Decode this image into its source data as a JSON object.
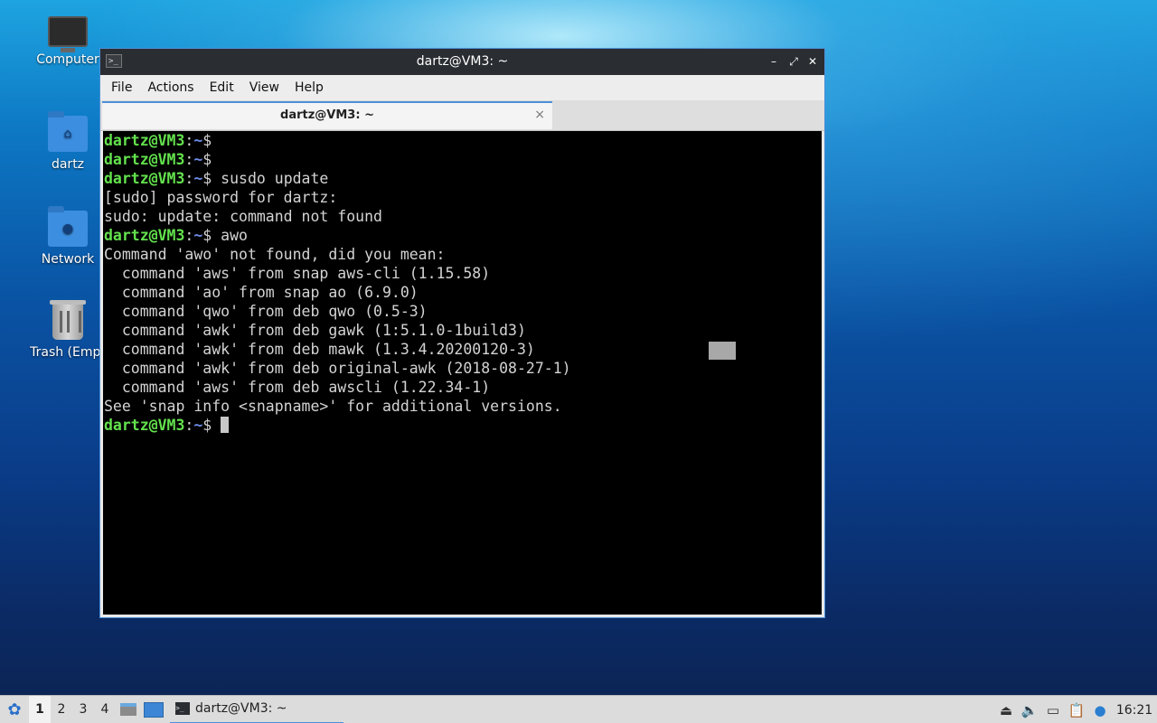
{
  "desktop": {
    "icons": [
      {
        "label": "Computer"
      },
      {
        "label": "dartz"
      },
      {
        "label": "Network"
      },
      {
        "label": "Trash (Empt"
      }
    ]
  },
  "window": {
    "title": "dartz@VM3: ~",
    "controls": {
      "minimize": "–",
      "maximize": "⤢",
      "close": "✕"
    },
    "menu": [
      "File",
      "Actions",
      "Edit",
      "View",
      "Help"
    ],
    "tab": {
      "label": "dartz@VM3: ~",
      "close": "×"
    }
  },
  "terminal": {
    "prompt_user": "dartz@VM3",
    "prompt_sep": ":",
    "prompt_path": "~",
    "prompt_sym": "$",
    "lines": [
      {
        "prompt": true,
        "text": ""
      },
      {
        "prompt": true,
        "text": ""
      },
      {
        "prompt": true,
        "text": " susdo update"
      },
      {
        "prompt": false,
        "text": "[sudo] password for dartz:"
      },
      {
        "prompt": false,
        "text": "sudo: update: command not found"
      },
      {
        "prompt": true,
        "text": " awo"
      },
      {
        "prompt": false,
        "text": "Command 'awo' not found, did you mean:"
      },
      {
        "prompt": false,
        "text": "  command 'aws' from snap aws-cli (1.15.58)"
      },
      {
        "prompt": false,
        "text": "  command 'ao' from snap ao (6.9.0)"
      },
      {
        "prompt": false,
        "text": "  command 'qwo' from deb qwo (0.5-3)"
      },
      {
        "prompt": false,
        "text": "  command 'awk' from deb gawk (1:5.1.0-1build3)"
      },
      {
        "prompt": false,
        "text": "  command 'awk' from deb mawk (1.3.4.20200120-3)"
      },
      {
        "prompt": false,
        "text": "  command 'awk' from deb original-awk (2018-08-27-1)"
      },
      {
        "prompt": false,
        "text": "  command 'aws' from deb awscli (1.22.34-1)"
      },
      {
        "prompt": false,
        "text": "See 'snap info <snapname>' for additional versions."
      },
      {
        "prompt": true,
        "text": " ",
        "cursor": true
      }
    ]
  },
  "taskbar": {
    "start_icon": "start-menu-icon",
    "workspaces": [
      "1",
      "2",
      "3",
      "4"
    ],
    "active_workspace": "1",
    "task_label": "dartz@VM3: ~",
    "clock": "16:21"
  },
  "colors": {
    "prompt_user": "#63e14d",
    "prompt_path": "#6d8de8",
    "accent": "#4d8fd8"
  }
}
